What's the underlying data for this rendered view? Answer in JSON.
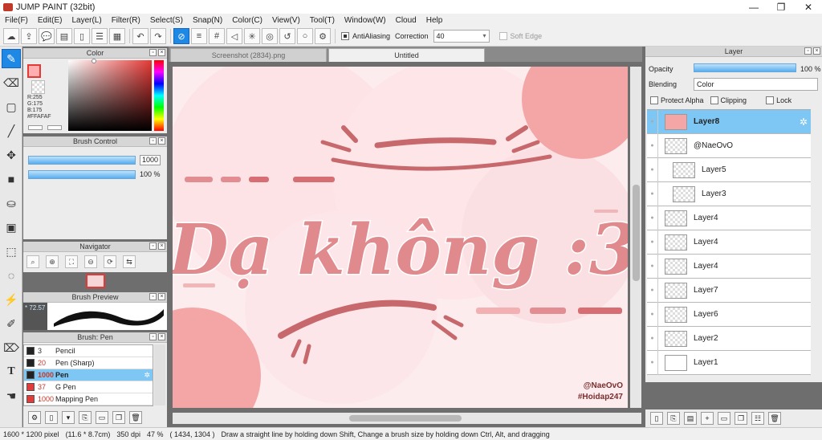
{
  "window": {
    "title": "JUMP PAINT (32bit)",
    "minimize": "—",
    "maximize": "❐",
    "close": "✕"
  },
  "menu": [
    "File(F)",
    "Edit(E)",
    "Layer(L)",
    "Filter(R)",
    "Select(S)",
    "Snap(N)",
    "Color(C)",
    "View(V)",
    "Tool(T)",
    "Window(W)",
    "Cloud",
    "Help"
  ],
  "toolbar": {
    "antialiasing_label": "AntiAliasing",
    "correction_label": "Correction",
    "correction_value": "40",
    "soft_edge_label": "Soft Edge"
  },
  "color_panel": {
    "title": "Color",
    "r": "R:255",
    "g": "G:175",
    "b": "B:175",
    "hex": "#FFAFAF",
    "current_color": "#FFAFAF"
  },
  "brush_control": {
    "title": "Brush Control",
    "size_value": "1000",
    "opacity_value": "100 %"
  },
  "navigator": {
    "title": "Navigator"
  },
  "brush_preview": {
    "title": "Brush Preview",
    "size_text": "* 72.57"
  },
  "brush_list": {
    "title": "Brush: Pen",
    "items": [
      {
        "size": "3",
        "name": "Pencil",
        "color": "#222222"
      },
      {
        "size": "20",
        "name": "Pen (Sharp)",
        "color": "#222222"
      },
      {
        "size": "1000",
        "name": "Pen",
        "color": "#222222"
      },
      {
        "size": "37",
        "name": "G Pen",
        "color": "#e03c3c"
      },
      {
        "size": "1000",
        "name": "Mapping Pen",
        "color": "#e03c3c"
      }
    ]
  },
  "doc_tabs": [
    "Screenshot (2834).png",
    "Untitled"
  ],
  "canvas": {
    "headline": "Dạ không :3",
    "credit_1": "@NaeOvO",
    "credit_2": "#Hoidap247"
  },
  "layer_panel": {
    "title": "Layer",
    "opacity_label": "Opacity",
    "opacity_value": "100 %",
    "blending_label": "Blending",
    "blending_value": "Color",
    "protect_alpha": "Protect Alpha",
    "clipping": "Clipping",
    "lock": "Lock",
    "layers": [
      {
        "name": "Layer8",
        "selected": true
      },
      {
        "name": "@NaeOvO",
        "selected": false
      },
      {
        "name": "Layer5",
        "selected": false
      },
      {
        "name": "Layer3",
        "selected": false
      },
      {
        "name": "Layer4",
        "selected": false
      },
      {
        "name": "Layer4",
        "selected": false
      },
      {
        "name": "Layer4",
        "selected": false
      },
      {
        "name": "Layer7",
        "selected": false
      },
      {
        "name": "Layer6",
        "selected": false
      },
      {
        "name": "Layer2",
        "selected": false
      },
      {
        "name": "Layer1",
        "selected": false
      }
    ]
  },
  "status": {
    "size": "1600 * 1200 pixel",
    "cm": "(11.6 * 8.7cm)",
    "dpi": "350 dpi",
    "zoom": "47 %",
    "coords": "( 1434, 1304 )",
    "hint": "Draw a straight line by holding down Shift, Change a brush size by holding down Ctrl, Alt, and dragging"
  }
}
